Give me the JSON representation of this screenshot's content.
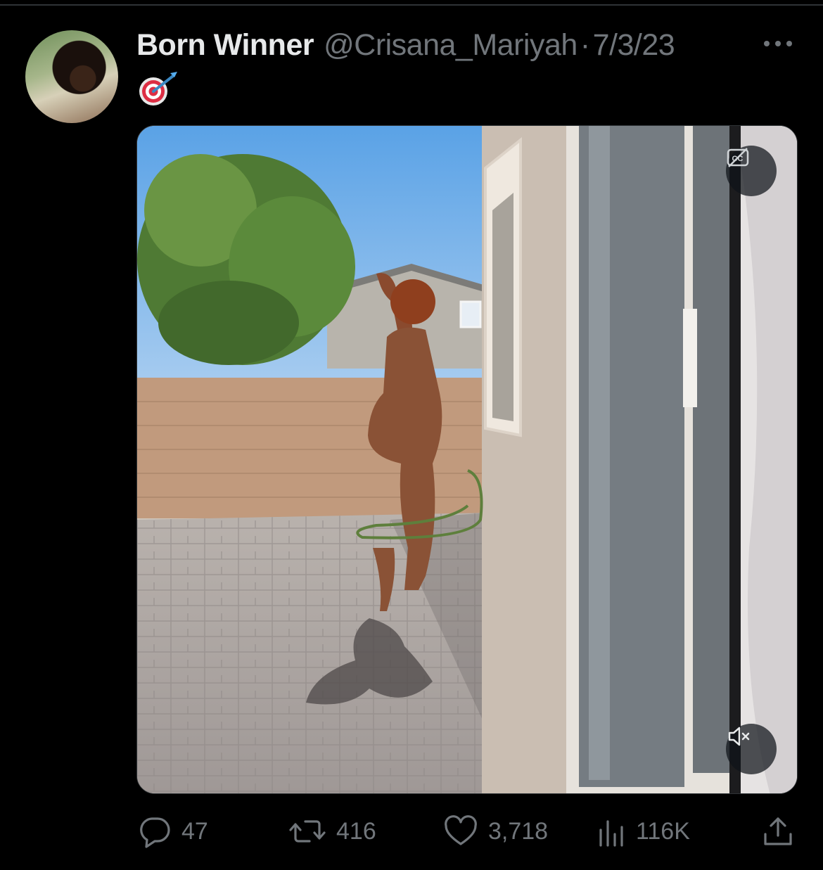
{
  "tweet": {
    "display_name": "Born Winner",
    "handle": "@Crisana_Mariyah",
    "separator": "·",
    "date": "7/3/23",
    "text_emoji": "🎯"
  },
  "media": {
    "type": "video",
    "captions_icon": "closed-captions-icon",
    "mute_icon": "muted-speaker-icon"
  },
  "actions": {
    "replies": "47",
    "reposts": "416",
    "likes": "3,718",
    "views": "116K"
  },
  "icons": {
    "more": "more-dots-icon",
    "reply": "reply-bubble-icon",
    "repost": "repost-arrows-icon",
    "like": "heart-icon",
    "views": "bar-chart-icon",
    "share": "share-upload-icon"
  },
  "colors": {
    "background": "#000000",
    "primary_text": "#e7e9ea",
    "secondary_text": "#71767b",
    "divider": "#2f3336"
  }
}
